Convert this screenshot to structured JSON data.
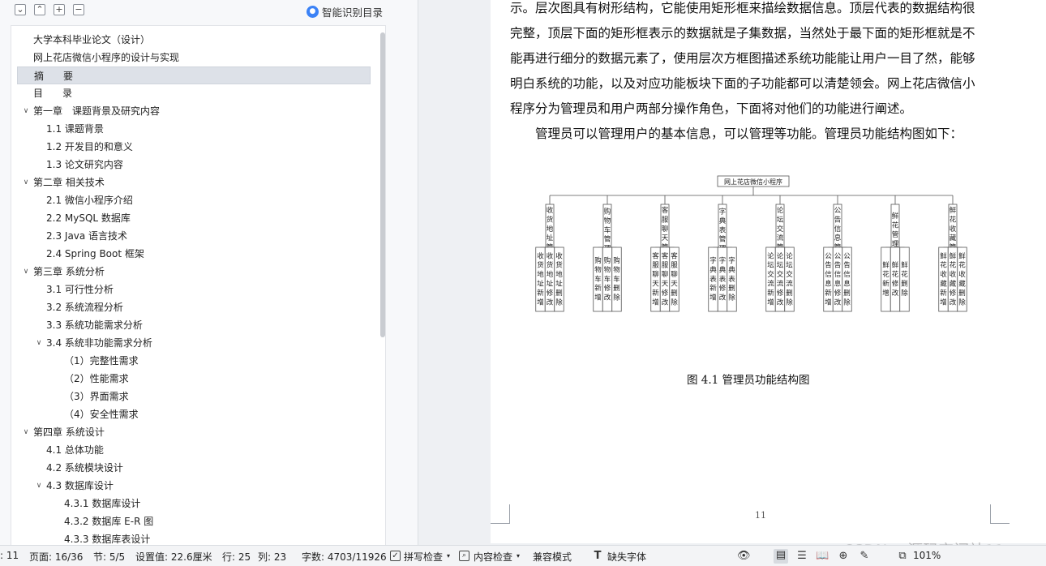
{
  "outline_toolbar": {
    "ai_label": "智能识别目录",
    "buttons": [
      "collapse-all",
      "expand-up",
      "add-heading",
      "remove-heading"
    ]
  },
  "outline": [
    {
      "text": "大学本科毕业论文（设计）",
      "level": 0,
      "chev": ""
    },
    {
      "text": "网上花店微信小程序的设计与实现",
      "level": 0,
      "chev": ""
    },
    {
      "text": "摘　　要",
      "level": 0,
      "chev": "",
      "selected": true
    },
    {
      "text": "目　　录",
      "level": 0,
      "chev": ""
    },
    {
      "text": "第一章　课题背景及研究内容",
      "level": 0,
      "chev": "v"
    },
    {
      "text": "1.1  课题背景",
      "level": 1,
      "chev": ""
    },
    {
      "text": "1.2  开发目的和意义",
      "level": 1,
      "chev": ""
    },
    {
      "text": "1.3  论文研究内容",
      "level": 1,
      "chev": ""
    },
    {
      "text": "第二章  相关技术",
      "level": 0,
      "chev": "v"
    },
    {
      "text": "2.1  微信小程序介绍",
      "level": 1,
      "chev": ""
    },
    {
      "text": "2.2 MySQL 数据库",
      "level": 1,
      "chev": ""
    },
    {
      "text": "2.3 Java 语言技术",
      "level": 1,
      "chev": ""
    },
    {
      "text": "2.4 Spring Boot 框架",
      "level": 1,
      "chev": ""
    },
    {
      "text": "第三章  系统分析",
      "level": 0,
      "chev": "v"
    },
    {
      "text": "3.1 可行性分析",
      "level": 1,
      "chev": ""
    },
    {
      "text": "3.2 系统流程分析",
      "level": 1,
      "chev": ""
    },
    {
      "text": "3.3 系统功能需求分析",
      "level": 1,
      "chev": ""
    },
    {
      "text": "3.4  系统非功能需求分析",
      "level": 1,
      "chev": "v"
    },
    {
      "text": "（1）完整性需求",
      "level": 2,
      "chev": ""
    },
    {
      "text": "（2）性能需求",
      "level": 2,
      "chev": ""
    },
    {
      "text": "（3）界面需求",
      "level": 2,
      "chev": ""
    },
    {
      "text": "（4）安全性需求",
      "level": 2,
      "chev": ""
    },
    {
      "text": "第四章  系统设计",
      "level": 0,
      "chev": "v"
    },
    {
      "text": "4.1  总体功能",
      "level": 1,
      "chev": ""
    },
    {
      "text": "4.2  系统模块设计",
      "level": 1,
      "chev": ""
    },
    {
      "text": "4.3  数据库设计",
      "level": 1,
      "chev": "v"
    },
    {
      "text": "4.3.1  数据库设计",
      "level": 2,
      "chev": ""
    },
    {
      "text": "4.3.2  数据库 E-R 图",
      "level": 2,
      "chev": ""
    },
    {
      "text": "4.3.3  数据库表设计",
      "level": 2,
      "chev": ""
    }
  ],
  "document": {
    "lines": [
      "示。层次图具有树形结构，它能使用矩形框来描绘数据信息。顶层代表的数据结构很",
      "完整，顶层下面的矩形框表示的数据就是子集数据，当然处于最下面的矩形框就是不",
      "能再进行细分的数据元素了，使用层次方框图描述系统功能能让用户一目了然，能够",
      "明白系统的功能，以及对应功能板块下面的子功能都可以清楚领会。网上花店微信小",
      "程序分为管理员和用户两部分操作角色，下面将对他们的功能进行阐述。",
      "　　管理员可以管理用户的基本信息，可以管理等功能。管理员功能结构图如下："
    ],
    "diagram": {
      "root": "网上花店微信小程序",
      "modules": [
        {
          "name": "收货地址管理",
          "children": [
            "收货地址新增",
            "收货地址修改",
            "收货地址删除"
          ]
        },
        {
          "name": "购物车管理",
          "children": [
            "购物车新增",
            "购物车修改",
            "购物车删除"
          ]
        },
        {
          "name": "客服聊天管理",
          "children": [
            "客服聊天新增",
            "客服聊天修改",
            "客服聊天删除"
          ]
        },
        {
          "name": "字典表管理",
          "children": [
            "字典表新增",
            "字典表修改",
            "字典表删除"
          ]
        },
        {
          "name": "论坛交流管理",
          "children": [
            "论坛交流新增",
            "论坛交流修改",
            "论坛交流删除"
          ]
        },
        {
          "name": "公告信息管理",
          "children": [
            "公告信息新增",
            "公告信息修改",
            "公告信息删除"
          ]
        },
        {
          "name": "鲜花管理",
          "children": [
            "鲜花新增",
            "鲜花修改",
            "鲜花删除"
          ]
        },
        {
          "name": "鲜花收藏管理",
          "children": [
            "鲜花收藏新增",
            "鲜花收藏修改",
            "鲜花收藏删除"
          ]
        }
      ]
    },
    "caption": "图 4.1  管理员功能结构图",
    "page_number": "11"
  },
  "statusbar": {
    "page_short": ": 11",
    "page": "页面: 16/36",
    "section": "节: 5/5",
    "setting": "设置值: 22.6厘米",
    "row": "行: 25",
    "col": "列: 23",
    "wordcount": "字数: 4703/11926",
    "spellcheck": "拼写检查",
    "contentcheck": "内容检查",
    "compat": "兼容模式",
    "missing_font": "缺失字体",
    "zoom": "101%"
  },
  "watermark": "CSDN @源码空间站11"
}
